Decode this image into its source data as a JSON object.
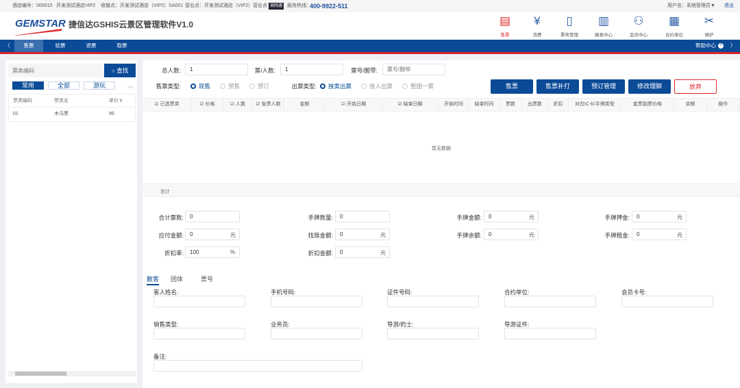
{
  "topbar": {
    "hotel_no": "酒店编号：000010",
    "hotel_name": "开发测试酒店VIP2",
    "cashier": "收银点：开发测试酒店（VIP2）SA001",
    "business": "营业点：开发测试酒店（VIP2）营业点",
    "badge": "测网通",
    "hotline_label": "服务热线：",
    "hotline": "400-9922-511",
    "user": "用户名：系统管理员▼",
    "logout": "退出"
  },
  "header": {
    "logo": "GEMSTAR",
    "title": "捷信达GSHIS云景区管理软件V1.0",
    "icons": [
      {
        "label": "售票",
        "icon": "ticket-icon"
      },
      {
        "label": "消费",
        "icon": "consume-icon"
      },
      {
        "label": "票务管理",
        "icon": "ticket-manage-icon"
      },
      {
        "label": "报表中心",
        "icon": "report-icon"
      },
      {
        "label": "会员中心",
        "icon": "member-icon"
      },
      {
        "label": "合约单位",
        "icon": "building-icon"
      },
      {
        "label": "维护",
        "icon": "tools-icon"
      }
    ]
  },
  "nav": {
    "prev": "〈",
    "items": [
      "售票",
      "验票",
      "退票",
      "取票"
    ],
    "help": "帮助中心",
    "next": "〉"
  },
  "left": {
    "search_placeholder": "票类编码",
    "search_btn": "查找",
    "tabs": [
      "常用",
      "全部",
      "游玩"
    ],
    "columns": [
      "票类编码",
      "票类名",
      "单价￥"
    ],
    "rows": [
      [
        "01",
        "木马票",
        "99"
      ]
    ]
  },
  "form": {
    "total_people_label": "总人数:",
    "total_people": "1",
    "per_ticket_label": "票/人数:",
    "per_ticket": "1",
    "ticket_no_label": "票号/腕带:",
    "ticket_no_placeholder": "票号/腕带",
    "sale_type_label": "售票类型:",
    "sale_types": [
      "现售",
      "预售",
      "预订"
    ],
    "issue_type_label": "出票类型:",
    "issue_types": [
      "按类出票",
      "按人出票",
      "整团一票"
    ]
  },
  "buttons": {
    "sell": "售票",
    "reprint": "售票补打",
    "booking": "预订管理",
    "modify": "修改理脚",
    "abandon": "放弃"
  },
  "table": {
    "columns": [
      "☑ 已选票类",
      "☑ 价格",
      "☑ 人数",
      "☑ 免票人数",
      "金额",
      "☑ 开始日期",
      "☑ 结束日期",
      "开始时间",
      "结束时间",
      "票数",
      "出票数",
      "折扣",
      "对应IC卡/手牌类型",
      "套票副票价格",
      "余额",
      "操作"
    ],
    "empty": "暂无数据",
    "total": "总计"
  },
  "summary": [
    {
      "label": "合计票数:",
      "value": "0",
      "unit": ""
    },
    {
      "label": "手牌数量:",
      "value": "0",
      "unit": ""
    },
    {
      "label": "手牌金额:",
      "value": "0",
      "unit": "元"
    },
    {
      "label": "手牌押金:",
      "value": "0",
      "unit": "元"
    },
    {
      "label": "应付金额:",
      "value": "0",
      "unit": "元"
    },
    {
      "label": "找赎金额:",
      "value": "0",
      "unit": "元"
    },
    {
      "label": "手牌余额:",
      "value": "0",
      "unit": "元"
    },
    {
      "label": "手牌租金:",
      "value": "0",
      "unit": "元"
    },
    {
      "label": "折扣率:",
      "value": "100",
      "unit": "%"
    },
    {
      "label": "折扣金额:",
      "value": "0",
      "unit": "元"
    }
  ],
  "guest_tabs": [
    "散客",
    "团体",
    "票号"
  ],
  "guest_fields": [
    "客人姓名:",
    "手机号码:",
    "证件号码:",
    "合约单位:",
    "会员卡号:",
    "销售类型:",
    "业务员:",
    "导游/的士:",
    "导游证件:",
    "备注:"
  ]
}
